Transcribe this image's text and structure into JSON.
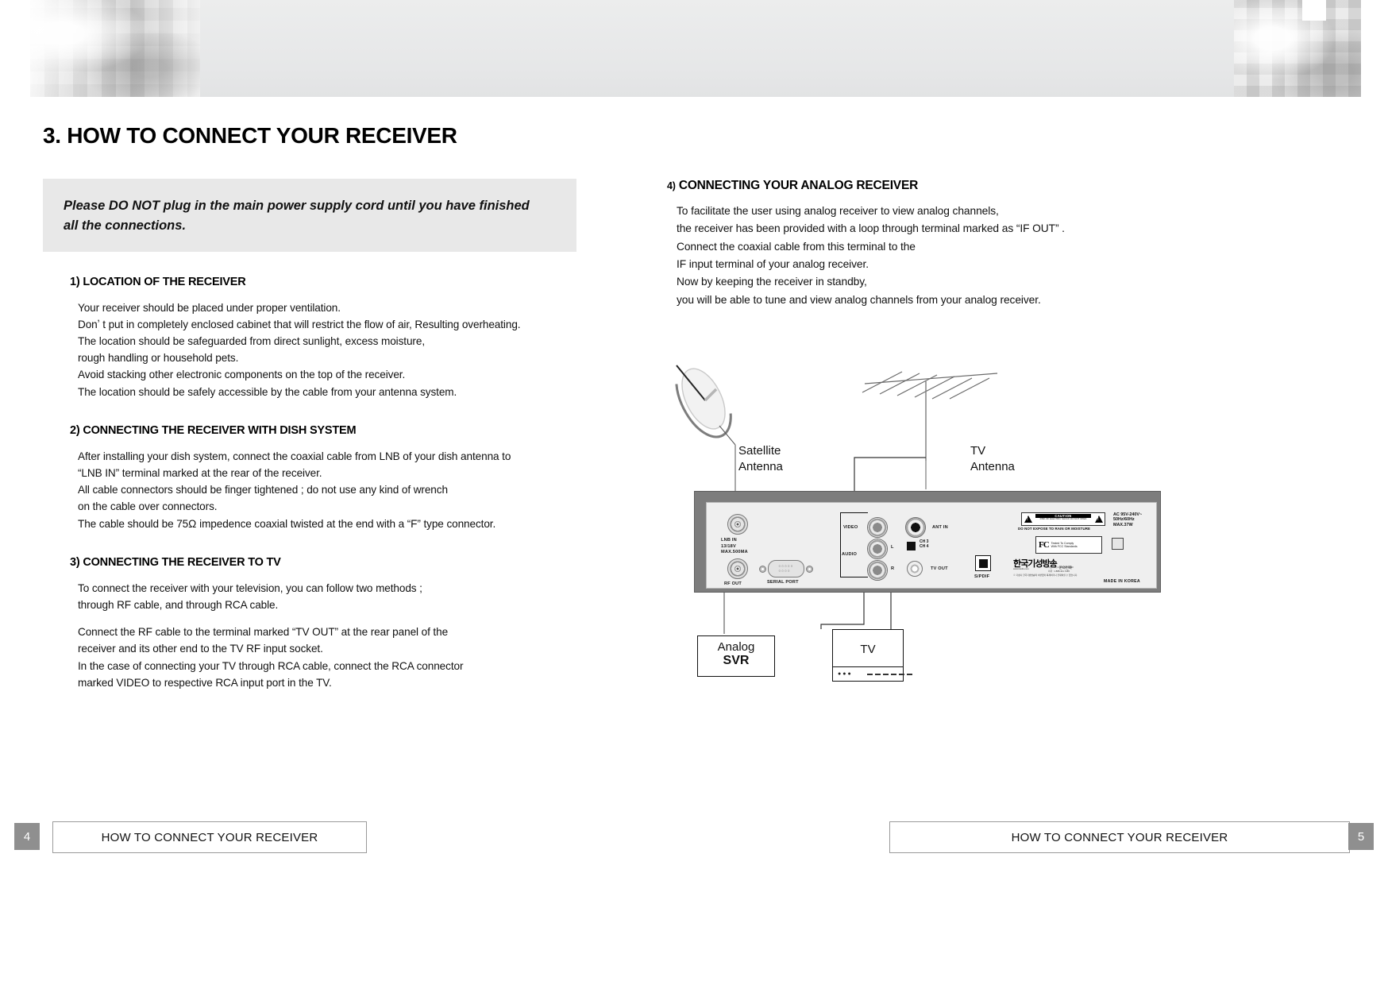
{
  "page": {
    "heading": "3. HOW TO CONNECT YOUR RECEIVER",
    "left_page_number": "4",
    "right_page_number": "5",
    "footer_left": "HOW TO CONNECT YOUR RECEIVER",
    "footer_right": "HOW TO CONNECT YOUR RECEIVER"
  },
  "notice": {
    "text": "Please DO NOT plug in the main power supply cord until you have finished all the connections."
  },
  "sections": [
    {
      "title": "1) LOCATION OF THE RECEIVER",
      "paragraphs": [
        [
          "Your receiver should be placed under proper ventilation.",
          "Donʼ t put in completely enclosed cabinet that will restrict the flow of air, Resulting overheating.",
          "The location should be safeguarded from direct sunlight, excess moisture,",
          "rough handling or household pets.",
          "Avoid stacking other electronic components on the top of the receiver.",
          "The location should be safely accessible by the cable from your antenna system."
        ]
      ]
    },
    {
      "title": "2) CONNECTING THE RECEIVER WITH DISH SYSTEM",
      "paragraphs": [
        [
          "After installing  your dish system, connect the coaxial cable from LNB of your dish antenna to",
          "“LNB IN”  terminal marked at the rear of the receiver.",
          "All cable connectors should be finger tightened ; do not use any kind of wrench",
          "on the cable over connectors.",
          "The cable should be 75Ω  impedence coaxial twisted at the end with a  “F”  type connector."
        ]
      ]
    },
    {
      "title": "3) CONNECTING THE RECEIVER TO TV",
      "paragraphs": [
        [
          "To connect the receiver with your television, you can follow two methods ;",
          "through RF cable, and through RCA cable."
        ],
        [
          "Connect the RF cable to the terminal marked  “TV OUT”  at the rear panel of the",
          "receiver and its other end to the TV RF input socket.",
          "In the case of connecting your TV through RCA cable, connect the RCA connector",
          "marked VIDEO to respective RCA  input port in the TV."
        ]
      ]
    }
  ],
  "right_section": {
    "number": "4)",
    "title": "CONNECTING YOUR ANALOG RECEIVER",
    "lines": [
      "To facilitate the user using analog receiver to view analog channels,",
      "the receiver has been provided with a loop through terminal marked as “IF OUT” .",
      "Connect the coaxial cable from this terminal to the",
      "IF input terminal of your analog receiver.",
      "Now by keeping the receiver in standby,",
      "you will be able to tune and view analog channels from your analog receiver."
    ]
  },
  "diagram": {
    "satellite_antenna_label": "Satellite\nAntenna",
    "tv_antenna_label": "TV\nAntenna",
    "analog_svr_line1": "Analog",
    "analog_svr_line2": "SVR",
    "tv_label": "TV",
    "panel": {
      "lnb_in": "LNB  IN\n13/18V\nMAX.500MA",
      "rf_out": "RF OUT",
      "serial_port": "SERIAL PORT",
      "video": "VIDEO",
      "audio": "AUDIO",
      "audio_l": "L",
      "audio_r": "R",
      "ant_in": "ANT  IN",
      "ch_select": "CH 3\nCH 4",
      "tv_out": "TV OUT",
      "spdif": "S/PDIF",
      "caution_head": "CAUTION",
      "caution_sub": "RISK OF ELECTRIC SHOCK\nDO NOT OPEN",
      "caution_note": "DO NOT EXPOSE TO RAIN OR MOISTURE",
      "fcc_mark": "FC",
      "fcc_text": "Tested To Comply\nWith FCC Standards",
      "kbs_logo": "한국기성방송",
      "kbs_sub": "문의전화",
      "kbs_tiny_1": "서울 : 02) 1.666.566.4040",
      "kbs_tiny_2": "미국 : 1.888.441.7285",
      "kbs_url": "www.kisdtv.com",
      "kbs_note": "※ 기성나 한국기성방송의 서면없이 복제하거나 전재하실 수 없습니다.",
      "ac_spec": "AC 95V-240V~\n50Hz/60Hz\nMAX.37W",
      "made_in": "MADE  IN  KOREA"
    }
  }
}
